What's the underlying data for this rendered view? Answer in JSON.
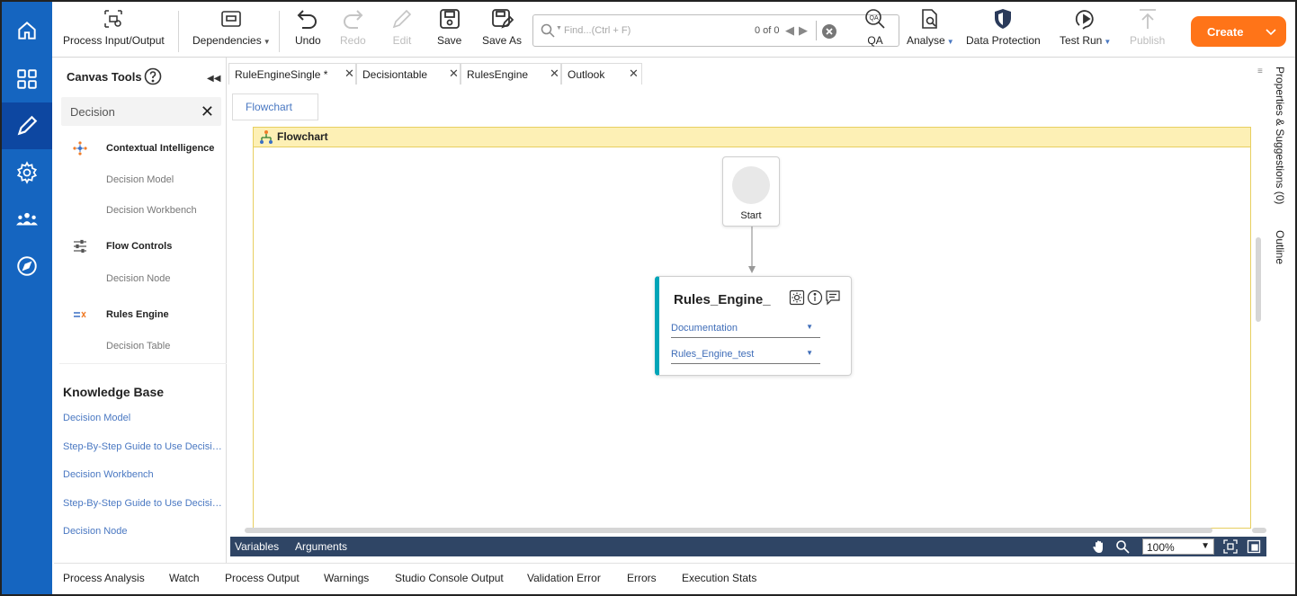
{
  "colors": {
    "rail": "#1565c0",
    "accent_orange": "#ff7418",
    "node_accent": "#00a5b8",
    "flowchart_header": "#fdf0b5",
    "varbar": "#2f4565",
    "link": "#4a78c2"
  },
  "rail": {
    "icons": [
      "home-icon",
      "grid-icon",
      "pencil-icon",
      "gear-icon",
      "people-icon",
      "compass-icon"
    ]
  },
  "toolbar": {
    "process_io": "Process Input/Output",
    "dependencies": "Dependencies",
    "undo": "Undo",
    "redo": "Redo",
    "edit": "Edit",
    "save": "Save",
    "save_as": "Save As",
    "find_placeholder": "Find...(Ctrl + F)",
    "find_count": "0 of 0",
    "qa": "QA",
    "analyse": "Analyse",
    "data_protection": "Data Protection",
    "test_run": "Test Run",
    "publish": "Publish",
    "create": "Create"
  },
  "tools": {
    "title": "Canvas Tools",
    "search_value": "Decision",
    "categories": [
      {
        "label": "Contextual Intelligence",
        "icon": "contextual-intelligence-icon",
        "items": [
          "Decision Model",
          "Decision Workbench"
        ]
      },
      {
        "label": "Flow Controls",
        "icon": "sliders-icon",
        "items": [
          "Decision Node"
        ]
      },
      {
        "label": "Rules Engine",
        "icon": "rules-engine-icon",
        "items": [
          "Decision Table"
        ]
      }
    ],
    "knowledge_base": {
      "title": "Knowledge Base",
      "links": [
        "Decision Model",
        "Step-By-Step Guide to Use Decisio...",
        "Decision Workbench",
        "Step-By-Step Guide to Use Decisio...",
        "Decision Node"
      ]
    }
  },
  "tabs": [
    "RuleEngineSingle *",
    "Decisiontable",
    "RulesEngine",
    "Outlook"
  ],
  "subtab": "Flowchart",
  "flowchart": {
    "title": "Flowchart",
    "start_label": "Start",
    "rule_node": {
      "title": "Rules_Engine_",
      "dropdown1": "Documentation",
      "dropdown2": "Rules_Engine_test"
    }
  },
  "varbar": {
    "variables": "Variables",
    "arguments": "Arguments",
    "zoom": "100%"
  },
  "side_panel": {
    "properties": "Properties & Suggestions (0)",
    "outline": "Outline"
  },
  "bottom_tabs": [
    "Process Analysis",
    "Watch",
    "Process Output",
    "Warnings",
    "Studio Console Output",
    "Validation Error",
    "Errors",
    "Execution Stats"
  ]
}
